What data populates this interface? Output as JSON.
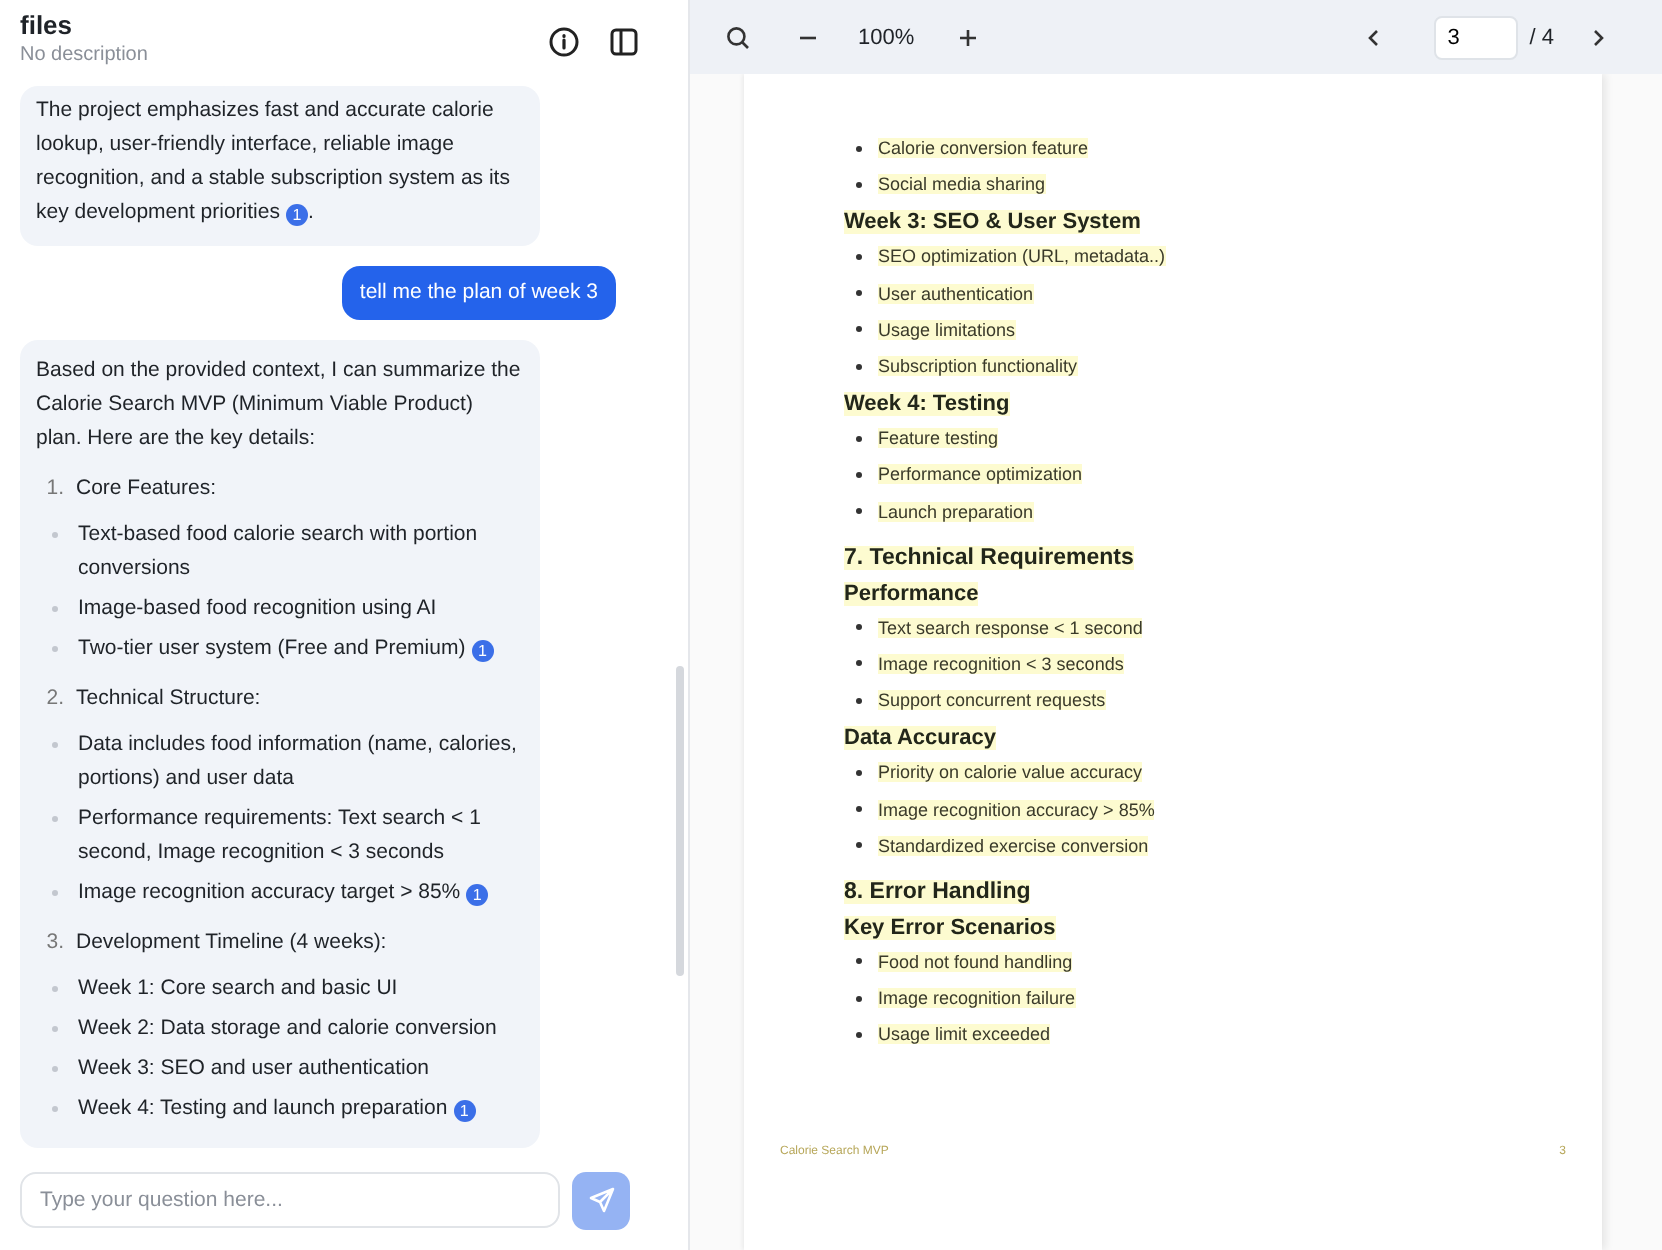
{
  "header": {
    "title": "files",
    "subtitle": "No description"
  },
  "messages": [
    {
      "kind": "assistant_text",
      "text": "The project emphasizes fast and accurate calorie lookup, user-friendly interface, reliable image recognition, and a stable subscription system as its key development priorities",
      "citation": "1",
      "tail": "."
    },
    {
      "kind": "user",
      "text": "tell me the plan of week 3"
    },
    {
      "kind": "assistant_list",
      "intro": "Based on the provided context, I can summarize the Calorie Search MVP (Minimum Viable Product) plan. Here are the key details:",
      "sections": [
        {
          "number": "1.",
          "title": "Core Features:",
          "items": [
            {
              "text": "Text-based food calorie search with portion conversions"
            },
            {
              "text": "Image-based food recognition using AI"
            },
            {
              "text": "Two-tier user system (Free and Premium)",
              "citation": "1"
            }
          ]
        },
        {
          "number": "2.",
          "title": "Technical Structure:",
          "items": [
            {
              "text": "Data includes food information (name, calories, portions) and user data"
            },
            {
              "text": "Performance requirements: Text search < 1 second, Image recognition < 3 seconds"
            },
            {
              "text": "Image recognition accuracy target > 85%",
              "citation": "1"
            }
          ]
        },
        {
          "number": "3.",
          "title": "Development Timeline (4 weeks):",
          "items": [
            {
              "text": "Week 1: Core search and basic UI"
            },
            {
              "text": "Week 2: Data storage and calorie conversion"
            },
            {
              "text": "Week 3: SEO and user authentication"
            },
            {
              "text": "Week 4: Testing and launch preparation",
              "citation": "1"
            }
          ]
        }
      ]
    }
  ],
  "input": {
    "placeholder": "Type your question here..."
  },
  "viewer": {
    "zoom": "100%",
    "page": "3",
    "total": "/ 4"
  },
  "document": {
    "blocks": [
      {
        "kind": "bullet",
        "text": "Calorie conversion feature",
        "highlighted": true
      },
      {
        "kind": "bullet",
        "text": "Social media sharing",
        "highlighted": true
      },
      {
        "kind": "subheading",
        "text": "Week 3: SEO & User System",
        "highlighted": true
      },
      {
        "kind": "bullet",
        "text": "SEO optimization (URL, metadata..)",
        "highlighted": true
      },
      {
        "kind": "bullet",
        "text": "User authentication",
        "highlighted": true
      },
      {
        "kind": "bullet",
        "text": "Usage limitations",
        "highlighted": true
      },
      {
        "kind": "bullet",
        "text": "Subscription functionality",
        "highlighted": true
      },
      {
        "kind": "subheading",
        "text": "Week 4: Testing",
        "highlighted": true
      },
      {
        "kind": "bullet",
        "text": "Feature testing",
        "highlighted": true
      },
      {
        "kind": "bullet",
        "text": "Performance optimization",
        "highlighted": true
      },
      {
        "kind": "bullet",
        "text": "Launch preparation",
        "highlighted": true
      },
      {
        "kind": "heading",
        "text": "7. Technical Requirements",
        "highlighted": true
      },
      {
        "kind": "subheading",
        "text": "Performance",
        "highlighted": true
      },
      {
        "kind": "bullet",
        "text": "Text search response < 1 second",
        "highlighted": true
      },
      {
        "kind": "bullet",
        "text": "Image recognition < 3 seconds",
        "highlighted": true
      },
      {
        "kind": "bullet",
        "text": "Support concurrent requests",
        "highlighted": true
      },
      {
        "kind": "subheading",
        "text": "Data Accuracy",
        "highlighted": true
      },
      {
        "kind": "bullet",
        "text": "Priority on calorie value accuracy",
        "highlighted": true
      },
      {
        "kind": "bullet",
        "text": "Image recognition accuracy > 85%",
        "highlighted": true
      },
      {
        "kind": "bullet",
        "text": "Standardized exercise conversion",
        "highlighted": true
      },
      {
        "kind": "heading",
        "text": "8. Error Handling",
        "highlighted": true
      },
      {
        "kind": "subheading",
        "text": "Key Error Scenarios",
        "highlighted": true
      },
      {
        "kind": "bullet",
        "text": "Food not found handling",
        "highlighted": true
      },
      {
        "kind": "bullet",
        "text": "Image recognition failure",
        "highlighted": true
      },
      {
        "kind": "bullet",
        "text": "Usage limit exceeded",
        "highlighted": true
      }
    ],
    "footer_title": "Calorie Search MVP",
    "footer_page": "3"
  }
}
